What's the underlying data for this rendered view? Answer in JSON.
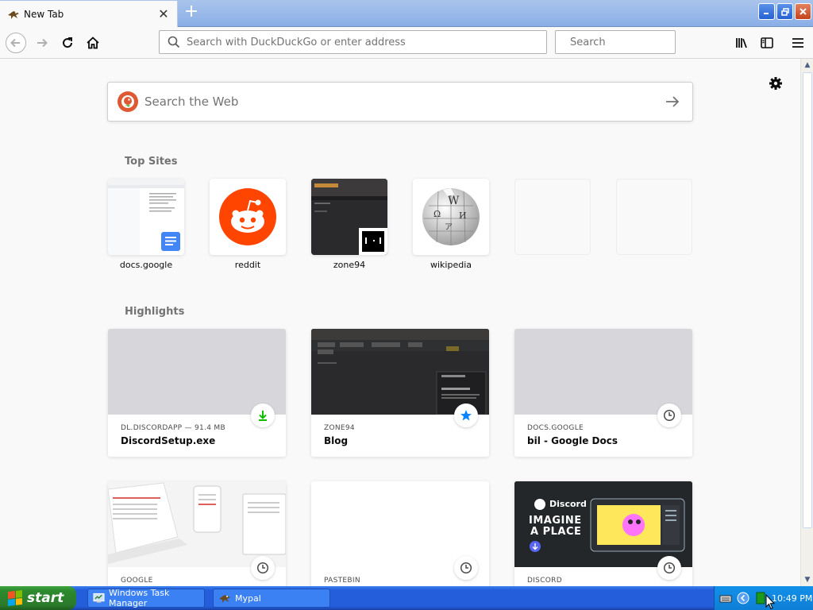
{
  "browser": {
    "tab": {
      "title": "New Tab",
      "close_glyph": "✕",
      "icon": "mypal-favicon"
    },
    "new_tab_glyph": "+",
    "urlbar": {
      "placeholder": "Search with DuckDuckGo or enter address",
      "value": ""
    },
    "searchbar": {
      "placeholder": "Search",
      "value": ""
    },
    "nav_icons": [
      "back-icon",
      "forward-icon",
      "reload-icon",
      "home-icon",
      "library-icon",
      "sidebar-icon",
      "menu-icon"
    ],
    "window_buttons": [
      "minimize",
      "restore",
      "close"
    ]
  },
  "newtab": {
    "web_search": {
      "placeholder": "Search the Web",
      "value": ""
    },
    "top_sites_title": "Top Sites",
    "top_sites": [
      {
        "label": "docs.google"
      },
      {
        "label": "reddit"
      },
      {
        "label": "zone94"
      },
      {
        "label": "wikipedia"
      },
      {
        "label": ""
      },
      {
        "label": ""
      }
    ],
    "highlights_title": "Highlights",
    "highlights": [
      {
        "source": "DL.DISCORDAPP — 91.4 MB",
        "title": "DiscordSetup.exe",
        "badge": "download-icon"
      },
      {
        "source": "ZONE94",
        "title": "Blog",
        "badge": "bookmark-star-icon"
      },
      {
        "source": "DOCS.GOOGLE",
        "title": "bil - Google Docs",
        "badge": "history-clock-icon"
      },
      {
        "source": "GOOGLE",
        "title": "",
        "badge": "history-clock-icon"
      },
      {
        "source": "PASTEBIN",
        "title": "",
        "badge": "history-clock-icon"
      },
      {
        "source": "DISCORD",
        "title": "",
        "badge": "history-clock-icon"
      }
    ],
    "discord_preview": {
      "brand": "Discord",
      "headline_1": "IMAGINE",
      "headline_2": "A PLACE"
    }
  },
  "taskbar": {
    "start_label": "start",
    "tasks": [
      {
        "label": "Windows Task Manager"
      },
      {
        "label": "Mypal"
      }
    ],
    "clock": "10:49 PM"
  },
  "colors": {
    "accent": "#0a84ff",
    "download_green": "#12bc00",
    "taskbar_blue": "#245edb",
    "start_green": "#2d8a2d",
    "reddit_orange": "#ff4500",
    "ddg_orange": "#de5833"
  }
}
